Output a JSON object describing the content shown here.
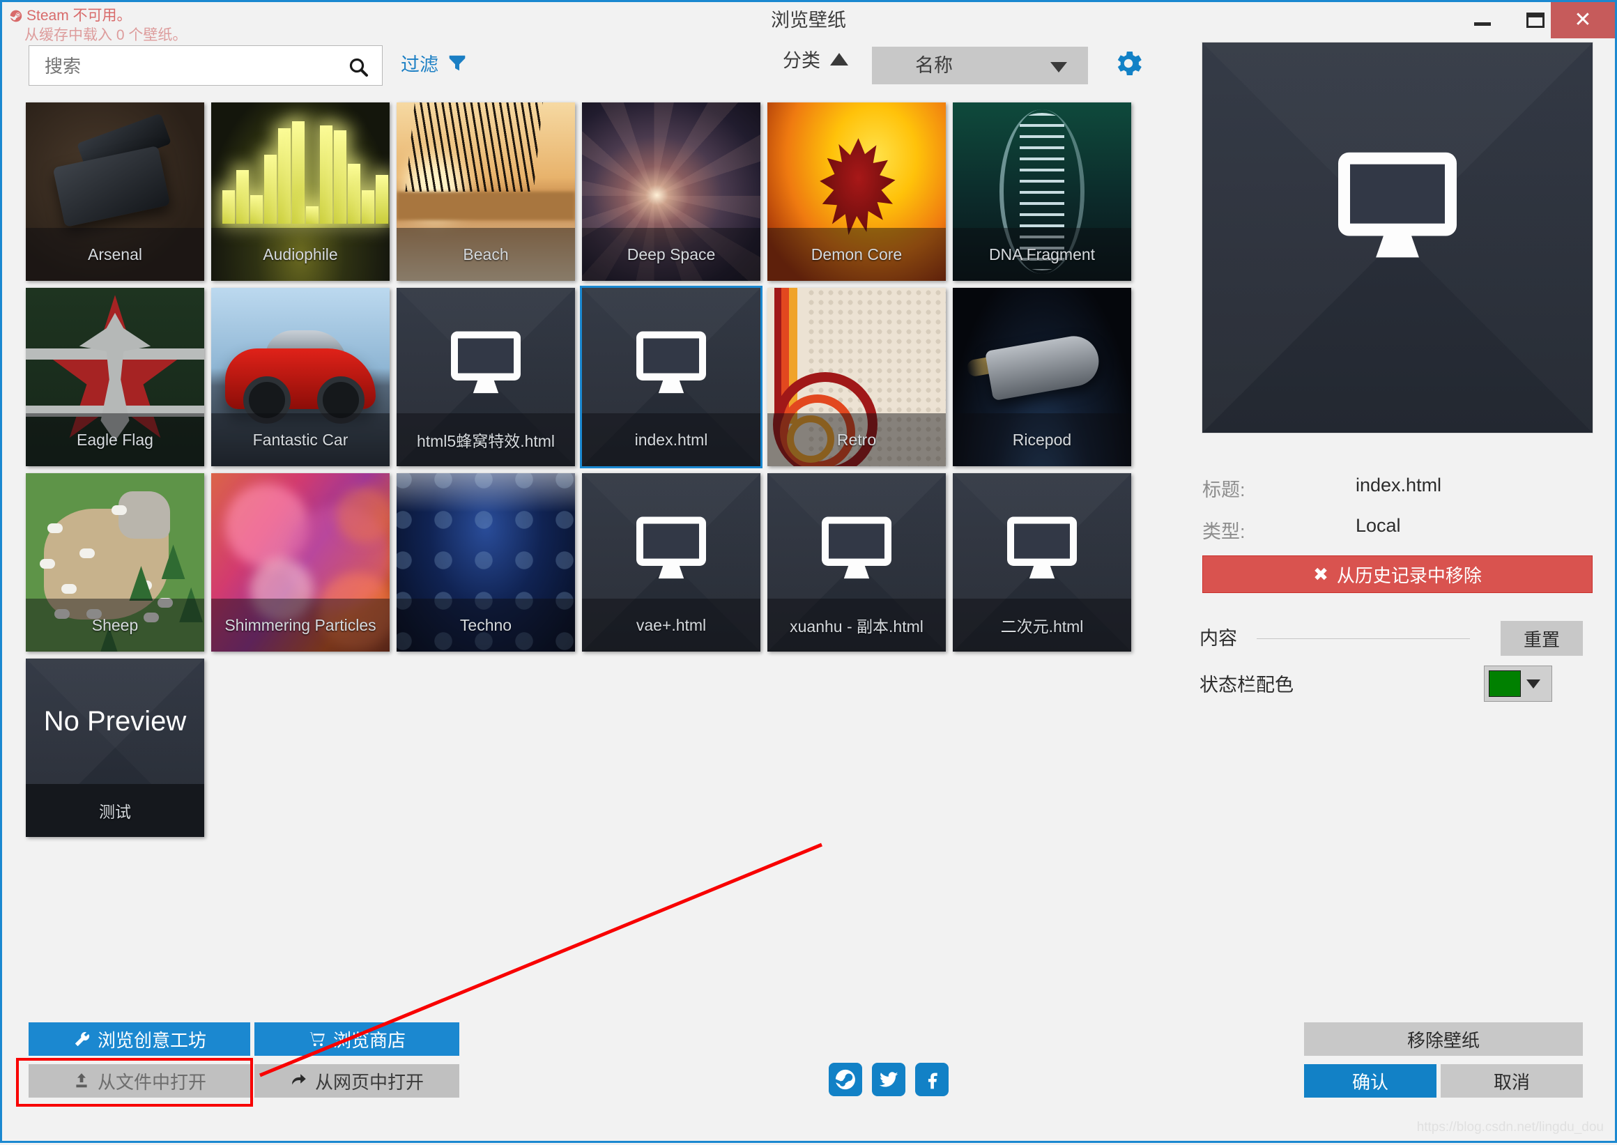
{
  "window": {
    "title": "浏览壁纸",
    "minimize_label": "–",
    "maximize_label": "□",
    "close_label": "✕",
    "accent_color": "#1b88d0"
  },
  "status_notice": {
    "line1": "Steam 不可用。",
    "line2": "从缓存中载入 0 个壁纸。",
    "color": "#d86a6a"
  },
  "toolbar": {
    "search_placeholder": "搜索",
    "search_value": "",
    "search_icon": "search-icon",
    "filter_label": "过滤",
    "filter_icon": "funnel-icon",
    "sort_label": "分类",
    "sort_direction_icon": "arrow-up-icon",
    "sort_select_value": "名称",
    "settings_icon": "gear-icon"
  },
  "grid": {
    "tiles": [
      {
        "label": "Arsenal",
        "art": "art-arsenal",
        "selected": false,
        "no_preview": false
      },
      {
        "label": "Audiophile",
        "art": "art-audio",
        "selected": false,
        "no_preview": false
      },
      {
        "label": "Beach",
        "art": "art-beach",
        "selected": false,
        "no_preview": false
      },
      {
        "label": "Deep Space",
        "art": "art-deep",
        "selected": false,
        "no_preview": false
      },
      {
        "label": "Demon Core",
        "art": "art-demon",
        "selected": false,
        "no_preview": false
      },
      {
        "label": "DNA Fragment",
        "art": "art-dna",
        "selected": false,
        "no_preview": false
      },
      {
        "label": "Eagle Flag",
        "art": "art-eagle",
        "selected": false,
        "no_preview": false
      },
      {
        "label": "Fantastic Car",
        "art": "art-car",
        "selected": false,
        "no_preview": false
      },
      {
        "label": "html5蜂窝特效.html",
        "art": "art-mono",
        "selected": false,
        "no_preview": false
      },
      {
        "label": "index.html",
        "art": "art-mono",
        "selected": true,
        "no_preview": false
      },
      {
        "label": "Retro",
        "art": "art-retro",
        "selected": false,
        "no_preview": false
      },
      {
        "label": "Ricepod",
        "art": "art-rice",
        "selected": false,
        "no_preview": false
      },
      {
        "label": "Sheep",
        "art": "art-sheep",
        "selected": false,
        "no_preview": false
      },
      {
        "label": "Shimmering Particles",
        "art": "art-shimmer",
        "selected": false,
        "no_preview": false
      },
      {
        "label": "Techno",
        "art": "art-techno",
        "selected": false,
        "no_preview": false
      },
      {
        "label": "vae+.html",
        "art": "art-mono",
        "selected": false,
        "no_preview": false
      },
      {
        "label": "xuanhu - 副本.html",
        "art": "art-mono",
        "selected": false,
        "no_preview": false
      },
      {
        "label": "二次元.html",
        "art": "art-mono",
        "selected": false,
        "no_preview": false
      },
      {
        "label": "测试",
        "art": "art-none",
        "selected": false,
        "no_preview": true,
        "no_preview_text": "No Preview"
      }
    ]
  },
  "details": {
    "preview_icon": "monitor-icon",
    "title_label": "标题:",
    "title_value": "index.html",
    "type_label": "类型:",
    "type_value": "Local",
    "remove_history_label": "从历史记录中移除",
    "remove_history_icon": "close-x-icon",
    "remove_history_color": "#d9534f",
    "content_label": "内容",
    "reset_label": "重置",
    "statusbar_color_label": "状态栏配色",
    "statusbar_color_value": "#008000",
    "color_caret_icon": "chevron-down-icon"
  },
  "footer": {
    "browse_workshop_label": "浏览创意工坊",
    "browse_workshop_icon": "wrench-icon",
    "browse_store_label": "浏览商店",
    "browse_store_icon": "cart-icon",
    "open_from_file_label": "从文件中打开",
    "open_from_file_icon": "upload-icon",
    "open_from_web_label": "从网页中打开",
    "open_from_web_icon": "arrow-right-icon",
    "remove_wallpaper_label": "移除壁纸",
    "confirm_label": "确认",
    "cancel_label": "取消",
    "social": [
      {
        "name": "steam-icon"
      },
      {
        "name": "twitter-icon"
      },
      {
        "name": "facebook-icon"
      }
    ]
  },
  "watermark": {
    "text": "https://blog.csdn.net/lingdu_dou"
  }
}
